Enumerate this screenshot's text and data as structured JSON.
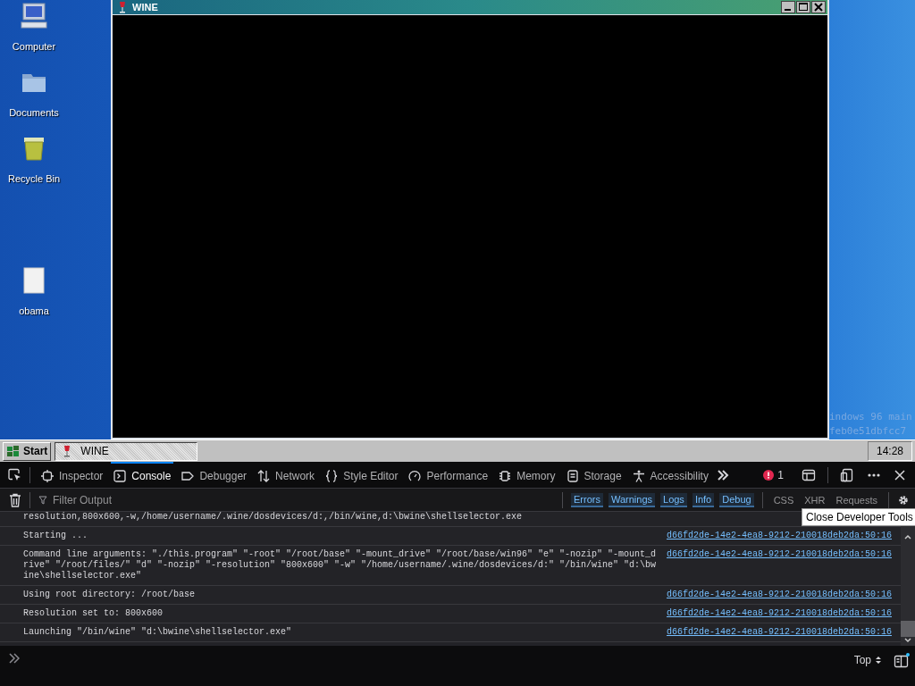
{
  "desktop": {
    "icons": [
      {
        "label": "Computer",
        "kind": "computer"
      },
      {
        "label": "Documents",
        "kind": "folder"
      },
      {
        "label": "Recycle Bin",
        "kind": "recycle"
      },
      {
        "label": "obama",
        "kind": "file"
      }
    ],
    "background_text": [
      "indows 96 main",
      "feb0e51dbfcc7"
    ]
  },
  "window": {
    "title": "WINE"
  },
  "taskbar": {
    "start": "Start",
    "tasks": [
      {
        "label": "WINE",
        "selected": true
      }
    ],
    "clock": "14:28"
  },
  "devtools": {
    "tabs": [
      {
        "label": "Inspector",
        "kind": "inspector",
        "selected": false
      },
      {
        "label": "Console",
        "kind": "console",
        "selected": true
      },
      {
        "label": "Debugger",
        "kind": "debugger",
        "selected": false
      },
      {
        "label": "Network",
        "kind": "network",
        "selected": false
      },
      {
        "label": "Style Editor",
        "kind": "style",
        "selected": false
      },
      {
        "label": "Performance",
        "kind": "performance",
        "selected": false
      },
      {
        "label": "Memory",
        "kind": "memory",
        "selected": false
      },
      {
        "label": "Storage",
        "kind": "storage",
        "selected": false
      },
      {
        "label": "Accessibility",
        "kind": "accessibility",
        "selected": false
      }
    ],
    "error_count": "1",
    "filter": {
      "placeholder": "Filter Output"
    },
    "levels": [
      {
        "label": "Errors",
        "selected": true
      },
      {
        "label": "Warnings",
        "selected": true
      },
      {
        "label": "Logs",
        "selected": true
      },
      {
        "label": "Info",
        "selected": true
      },
      {
        "label": "Debug",
        "selected": true
      }
    ],
    "types": [
      {
        "label": "CSS",
        "selected": false
      },
      {
        "label": "XHR",
        "selected": false
      },
      {
        "label": "Requests",
        "selected": false
      }
    ],
    "messages": [
      {
        "text": "resolution,800x600,-w,/home/username/.wine/dosdevices/d:,/bin/wine,d:\\bwine\\shellselector.exe"
      },
      {
        "text": "Starting ...",
        "source": "d66fd2de-14e2-4ea8-9212-210018deb2da:50:16"
      },
      {
        "text": "Command line arguments: \"./this.program\" \"-root\" \"/root/base\" \"-mount_drive\" \"/root/base/win96\" \"e\" \"-nozip\" \"-mount_drive\" \"/root/files/\" \"d\" \"-nozip\" \"-resolution\" \"800x600\" \"-w\" \"/home/username/.wine/dosdevices/d:\" \"/bin/wine\" \"d:\\bwine\\shellselector.exe\"",
        "source": "d66fd2de-14e2-4ea8-9212-210018deb2da:50:16"
      },
      {
        "text": "Using root directory: /root/base",
        "source": "d66fd2de-14e2-4ea8-9212-210018deb2da:50:16"
      },
      {
        "text": "Resolution set to: 800x600",
        "source": "d66fd2de-14e2-4ea8-9212-210018deb2da:50:16"
      },
      {
        "text": "Launching \"/bin/wine\" \"d:\\bwine\\shellselector.exe\"",
        "source": "d66fd2de-14e2-4ea8-9212-210018deb2da:50:16"
      }
    ],
    "context": "Top",
    "tooltip": "Close Developer Tools"
  }
}
